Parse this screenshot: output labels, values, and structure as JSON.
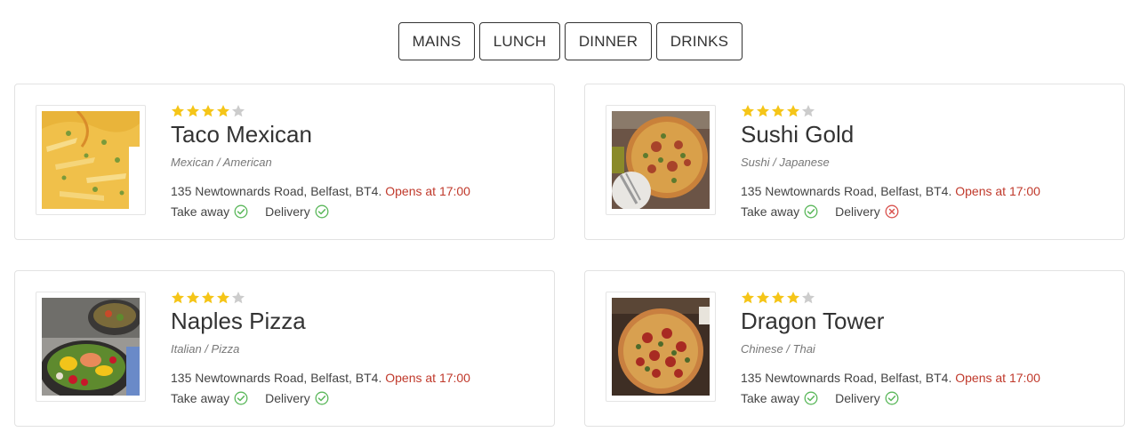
{
  "tabs": [
    {
      "label": "MAINS"
    },
    {
      "label": "LUNCH"
    },
    {
      "label": "DINNER"
    },
    {
      "label": "DRINKS"
    }
  ],
  "colors": {
    "star_filled": "#f5c518",
    "star_empty": "#cccccc",
    "opens_text": "#c0392b",
    "available": "#5cb85c",
    "unavailable": "#d9534f"
  },
  "restaurants": [
    {
      "name": "Taco Mexican",
      "cuisine": "Mexican / American",
      "rating": 4,
      "rating_max": 5,
      "address": "135 Newtownards Road, Belfast, BT4.",
      "opens": "Opens at 17:00",
      "takeaway_label": "Take away",
      "takeaway_available": true,
      "delivery_label": "Delivery",
      "delivery_available": true,
      "image_icon": "loaded-fries-photo"
    },
    {
      "name": "Sushi Gold",
      "cuisine": "Sushi / Japanese",
      "rating": 4,
      "rating_max": 5,
      "address": "135 Newtownards Road, Belfast, BT4.",
      "opens": "Opens at 17:00",
      "takeaway_label": "Take away",
      "takeaway_available": true,
      "delivery_label": "Delivery",
      "delivery_available": false,
      "image_icon": "pizza-photo"
    },
    {
      "name": "Naples Pizza",
      "cuisine": "Italian / Pizza",
      "rating": 4,
      "rating_max": 5,
      "address": "135 Newtownards Road, Belfast, BT4.",
      "opens": "Opens at 17:00",
      "takeaway_label": "Take away",
      "takeaway_available": true,
      "delivery_label": "Delivery",
      "delivery_available": true,
      "image_icon": "salad-bowl-photo"
    },
    {
      "name": "Dragon Tower",
      "cuisine": "Chinese / Thai",
      "rating": 4,
      "rating_max": 5,
      "address": "135 Newtownards Road, Belfast, BT4.",
      "opens": "Opens at 17:00",
      "takeaway_label": "Take away",
      "takeaway_available": true,
      "delivery_label": "Delivery",
      "delivery_available": true,
      "image_icon": "pepperoni-pizza-photo"
    }
  ]
}
